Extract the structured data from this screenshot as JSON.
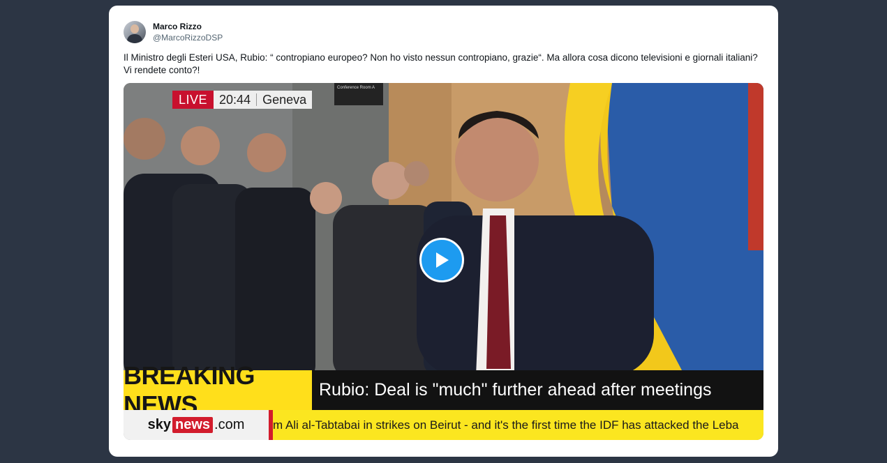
{
  "tweet": {
    "author_name": "Marco Rizzo",
    "author_handle": "@MarcoRizzoDSP",
    "text_line1": "Il Ministro degli Esteri USA, Rubio: “ contropiano europeo? Non ho visto nessun contropiano, grazie“. Ma allora cosa dicono televisioni e giornali italiani?",
    "text_line2": "Vi rendete conto?!"
  },
  "video": {
    "live_label": "LIVE",
    "time": "20:44",
    "location": "Geneva",
    "sign_text": "Conference Room A",
    "breaking_label": "BREAKING NEWS",
    "headline": "Rubio: Deal is \"much\" further ahead after meetings",
    "logo_sky": "sky",
    "logo_news": "news",
    "logo_com": ".com",
    "ticker": "m Ali al-Tabtabai in strikes on Beirut - and it's the first time the IDF has attacked the Leba",
    "play_icon": "play-icon"
  },
  "colors": {
    "page_bg": "#2c3544",
    "card_bg": "#ffffff",
    "play_blue": "#1d9bf0",
    "live_red": "#c8102e",
    "breaking_yellow": "#ffdf1b",
    "ticker_yellow": "#fbe620"
  }
}
